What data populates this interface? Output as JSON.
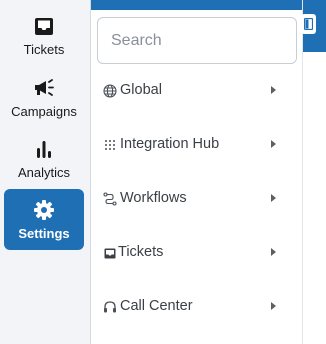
{
  "nav": {
    "items": [
      {
        "label": "Tickets",
        "icon": "inbox-icon"
      },
      {
        "label": "Campaigns",
        "icon": "megaphone-icon"
      },
      {
        "label": "Analytics",
        "icon": "bar-chart-icon"
      },
      {
        "label": "Settings",
        "icon": "gear-icon",
        "active": true
      }
    ]
  },
  "submenu": {
    "search_placeholder": "Search",
    "items": [
      {
        "label": "Global",
        "icon": "globe-icon"
      },
      {
        "label": "Integration Hub",
        "icon": "grid-dots-icon"
      },
      {
        "label": "Workflows",
        "icon": "workflow-icon"
      },
      {
        "label": "Tickets",
        "icon": "inbox-icon"
      },
      {
        "label": "Call Center",
        "icon": "headset-icon"
      }
    ]
  },
  "colors": {
    "accent": "#1f6fb5",
    "rail_bg": "#f2f4f7",
    "text": "#3b4046"
  }
}
